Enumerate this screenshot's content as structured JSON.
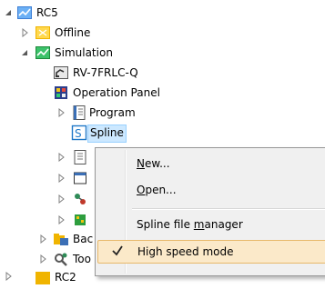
{
  "tree": {
    "root": {
      "label": "RC5",
      "icon": "robot-controller-icon"
    },
    "offline": {
      "label": "Offline",
      "icon": "offline-folder-icon"
    },
    "simulation": {
      "label": "Simulation",
      "icon": "simulation-icon"
    },
    "robot": {
      "label": "RV-7FRLC-Q",
      "icon": "robot-model-icon"
    },
    "operation_panel": {
      "label": "Operation Panel",
      "icon": "operation-panel-icon"
    },
    "program": {
      "label": "Program",
      "icon": "program-icon"
    },
    "spline": {
      "label": "Spline",
      "icon": "spline-icon"
    },
    "bac": {
      "label": "Bac",
      "icon": "backup-icon"
    },
    "too": {
      "label": "Too",
      "icon": "tools-icon"
    },
    "rc2": {
      "label": "RC2",
      "icon": "robot-controller-icon"
    }
  },
  "context_menu": {
    "new": {
      "pre": "",
      "accel": "N",
      "post": "ew..."
    },
    "open": {
      "pre": "",
      "accel": "O",
      "post": "pen..."
    },
    "spline_manager": {
      "pre": "Spline file ",
      "accel": "m",
      "post": "anager"
    },
    "high_speed": {
      "label": "High speed mode",
      "checked": true
    }
  },
  "colors": {
    "highlight": "#fbe9c9",
    "highlight_border": "#e7b86a",
    "selection": "#cce8ff"
  }
}
